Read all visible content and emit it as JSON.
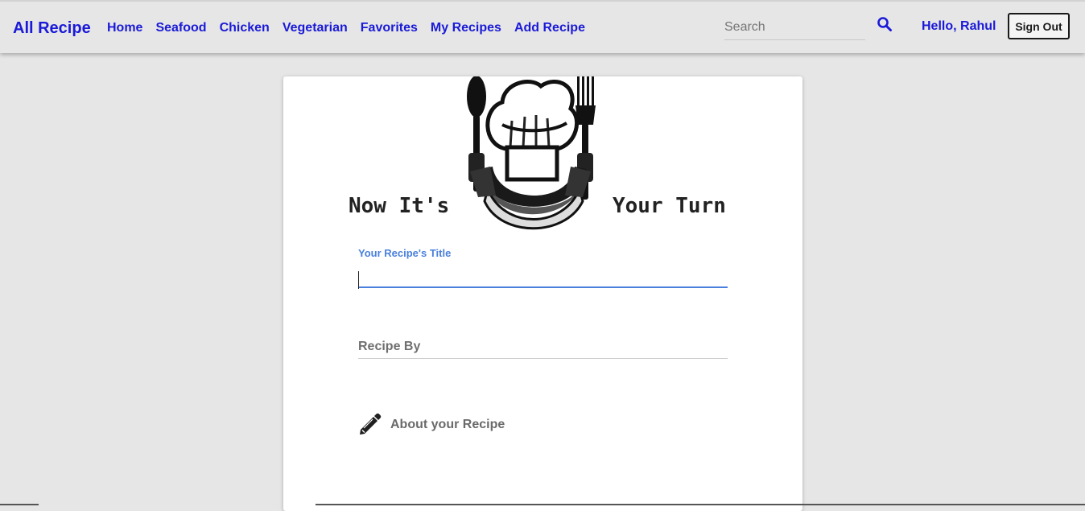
{
  "navbar": {
    "brand": "All Recipe",
    "links": [
      "Home",
      "Seafood",
      "Chicken",
      "Vegetarian",
      "Favorites",
      "My Recipes",
      "Add Recipe"
    ],
    "search": {
      "placeholder": "Search",
      "icon": "search-icon"
    },
    "greeting": "Hello, Rahul",
    "sign_out": "Sign Out"
  },
  "form": {
    "heading_left": "Now It's",
    "heading_right": "Your Turn",
    "logo_icon": "chef-hat-spoon-fork-icon",
    "title_field": {
      "label": "Your Recipe's Title",
      "value": ""
    },
    "recipe_by_field": {
      "placeholder": "Recipe By",
      "value": ""
    },
    "about_field": {
      "icon": "pencil-icon",
      "label": "About your Recipe"
    }
  },
  "colors": {
    "accent": "#1a1ad8",
    "focus_blue": "#4a80dd",
    "background": "#e6e6e6",
    "card": "#ffffff"
  }
}
